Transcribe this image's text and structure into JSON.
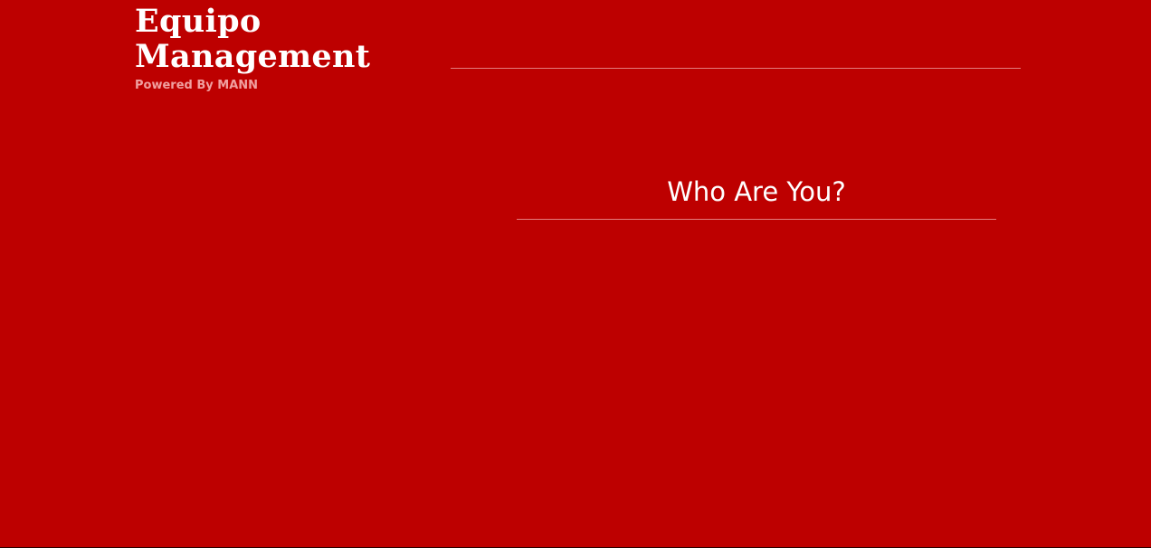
{
  "brand": {
    "title_line1": "Equipo",
    "title_line2": "Management",
    "subtitle": "Powered By MANN"
  },
  "login": {
    "heading": "Who Are You?"
  },
  "colors": {
    "background": "#bd0000",
    "subtitle": "#f0a0a0",
    "rule": "#e47d7d"
  }
}
